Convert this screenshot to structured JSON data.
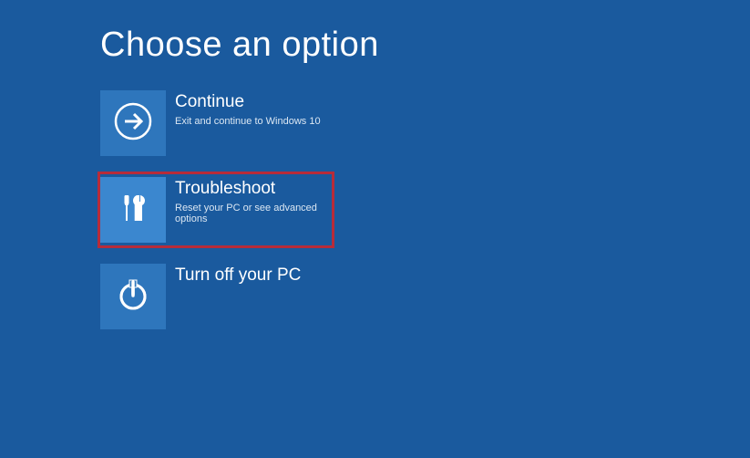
{
  "title": "Choose an option",
  "options": {
    "continue": {
      "title": "Continue",
      "desc": "Exit and continue to Windows 10"
    },
    "troubleshoot": {
      "title": "Troubleshoot",
      "desc": "Reset your PC or see advanced options"
    },
    "turnoff": {
      "title": "Turn off your PC",
      "desc": ""
    }
  },
  "colors": {
    "background": "#1a5a9e",
    "tile": "#2e76bc",
    "tile_highlight": "#3b87cf",
    "highlight_border": "#b72c3a"
  }
}
